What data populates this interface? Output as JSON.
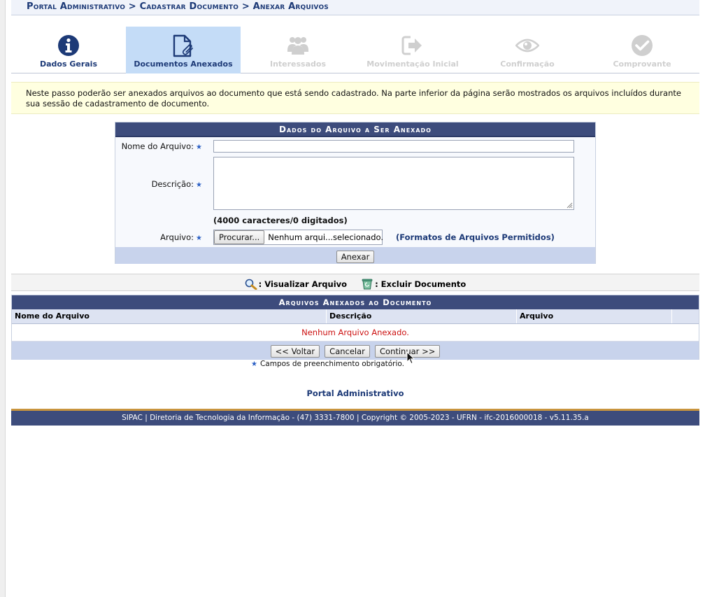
{
  "breadcrumb": "Portal Administrativo > Cadastrar Documento > Anexar Arquivos",
  "steps": [
    {
      "label": "Dados Gerais",
      "icon": "info-icon",
      "state": "done"
    },
    {
      "label": "Documentos Anexados",
      "icon": "attachment-icon",
      "state": "active"
    },
    {
      "label": "Interessados",
      "icon": "users-icon",
      "state": "todo"
    },
    {
      "label": "Movimentação Inicial",
      "icon": "sign-out-icon",
      "state": "todo"
    },
    {
      "label": "Confirmação",
      "icon": "eye-icon",
      "state": "todo"
    },
    {
      "label": "Comprovante",
      "icon": "check-icon",
      "state": "todo"
    }
  ],
  "notice": "Neste passo poderão ser anexados arquivos ao documento que está sendo cadastrado. Na parte inferior da página serão mostrados os arquivos incluídos durante sua sessão de cadastramento de documento.",
  "form": {
    "title": "Dados do Arquivo a Ser Anexado",
    "name_label": "Nome do Arquivo:",
    "name_value": "",
    "description_label": "Descrição:",
    "description_value": "",
    "counter": "(4000 caracteres/0 digitados)",
    "file_label": "Arquivo:",
    "browse_label": "Procurar...",
    "file_status": "Nenhum arqui...selecionado.",
    "formats_link": "(Formatos de Arquivos Permitidos)",
    "attach_button": "Anexar",
    "required_star": "★"
  },
  "legend": {
    "view": ": Visualizar Arquivo",
    "delete": ": Excluir Documento"
  },
  "listing": {
    "title": "Arquivos Anexados ao Documento",
    "columns": [
      "Nome do Arquivo",
      "Descrição",
      "Arquivo",
      ""
    ],
    "empty_message": "Nenhum Arquivo Anexado.",
    "back_button": "<< Voltar",
    "cancel_button": "Cancelar",
    "continue_button": "Continuar >>"
  },
  "required_note": "Campos de preenchimento obrigatório.",
  "portal_link": "Portal Administrativo",
  "footer": "SIPAC | Diretoria de Tecnologia da Informação - (47) 3331-7800 | Copyright © 2005-2023 - UFRN - ifc-2016000018 - v5.11.35.a",
  "colors": {
    "header_blue": "#3d4c7c",
    "link_blue": "#1d3a77",
    "active_step": "#c4dcf7",
    "inactive_step": "#cfcfcf",
    "error_red": "#cc1111",
    "footer_accent": "#c9953e"
  }
}
